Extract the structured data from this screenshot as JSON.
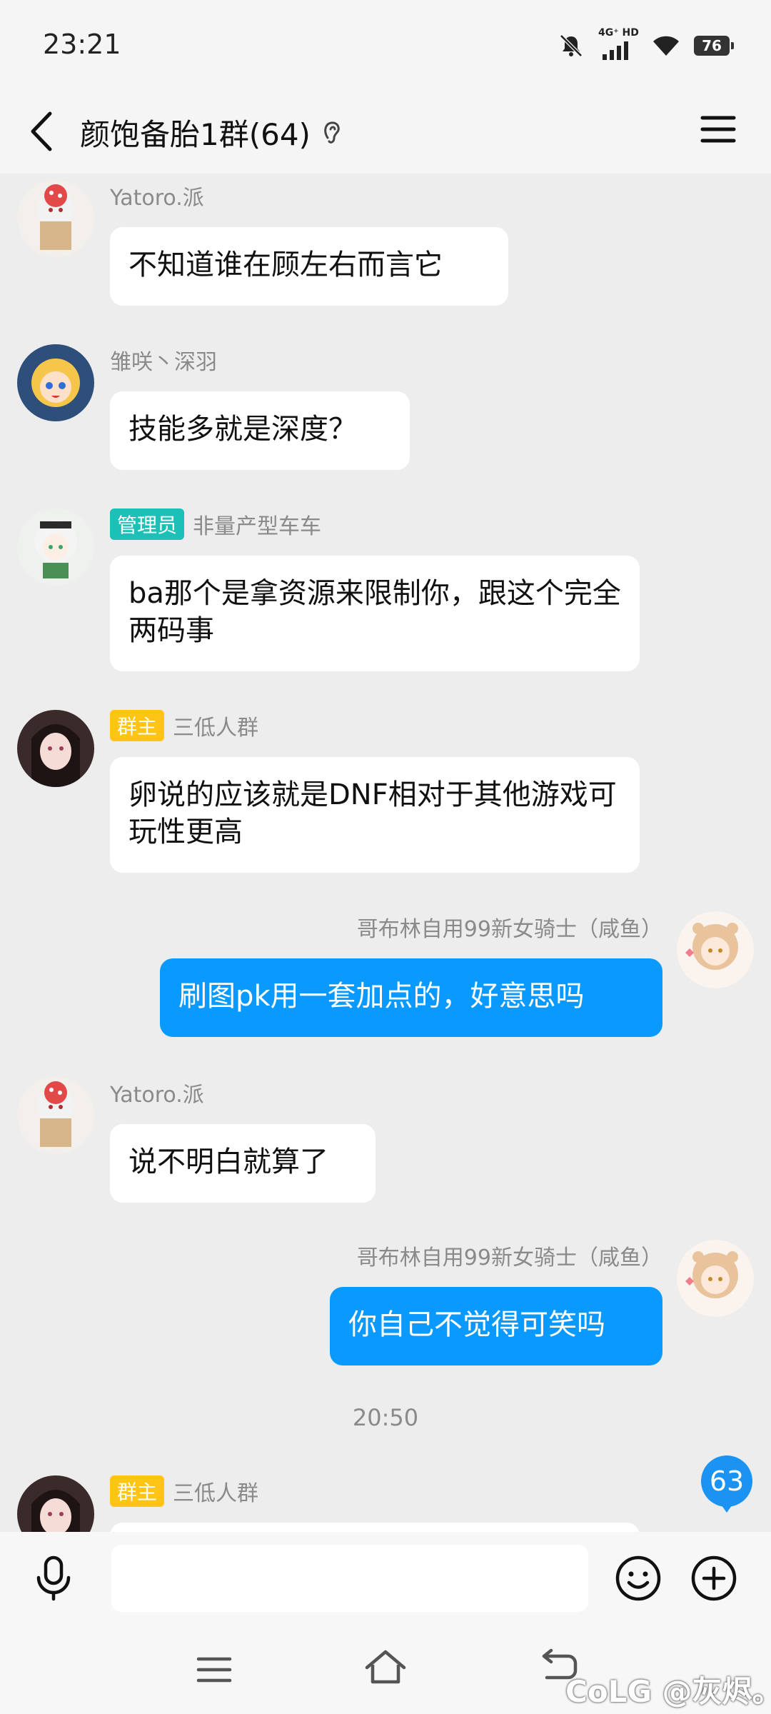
{
  "status": {
    "time": "23:21",
    "network": "4G⁺ HD",
    "battery": "76"
  },
  "header": {
    "title": "颜饱备胎1群(64)"
  },
  "messages": [
    {
      "sender": "Yatoro.派",
      "badge": "",
      "text": "不知道谁在顾左右而言它"
    },
    {
      "sender": "雏咲丶深羽",
      "badge": "",
      "text": "技能多就是深度？"
    },
    {
      "sender": "非量产型车车",
      "badge": "管理员",
      "text": "ba那个是拿资源来限制你，跟这个完全两码事"
    },
    {
      "sender": "三低人群",
      "badge": "群主",
      "text": "卵说的应该就是DNF相对于其他游戏可玩性更高"
    },
    {
      "sender": "哥布林自用99新女骑士（咸鱼）",
      "badge": "",
      "text": "刷图pk用一套加点的，好意思吗"
    },
    {
      "sender": "Yatoro.派",
      "badge": "",
      "text": "说不明白就算了"
    },
    {
      "sender": "哥布林自用99新女骑士（咸鱼）",
      "badge": "",
      "text": "你自己不觉得可笑吗"
    },
    {
      "sender": "三低人群",
      "badge": "群主",
      "text": ""
    }
  ],
  "timestamp": "20:50",
  "unread_count": "63",
  "input": {
    "value": ""
  },
  "watermark": "CoLG @灰烬。",
  "colors": {
    "outgoing_bubble": "#0a99ff",
    "incoming_bubble": "#ffffff",
    "admin_badge": "#1dc0b6",
    "owner_badge": "#ffc414",
    "background": "#ededed"
  }
}
